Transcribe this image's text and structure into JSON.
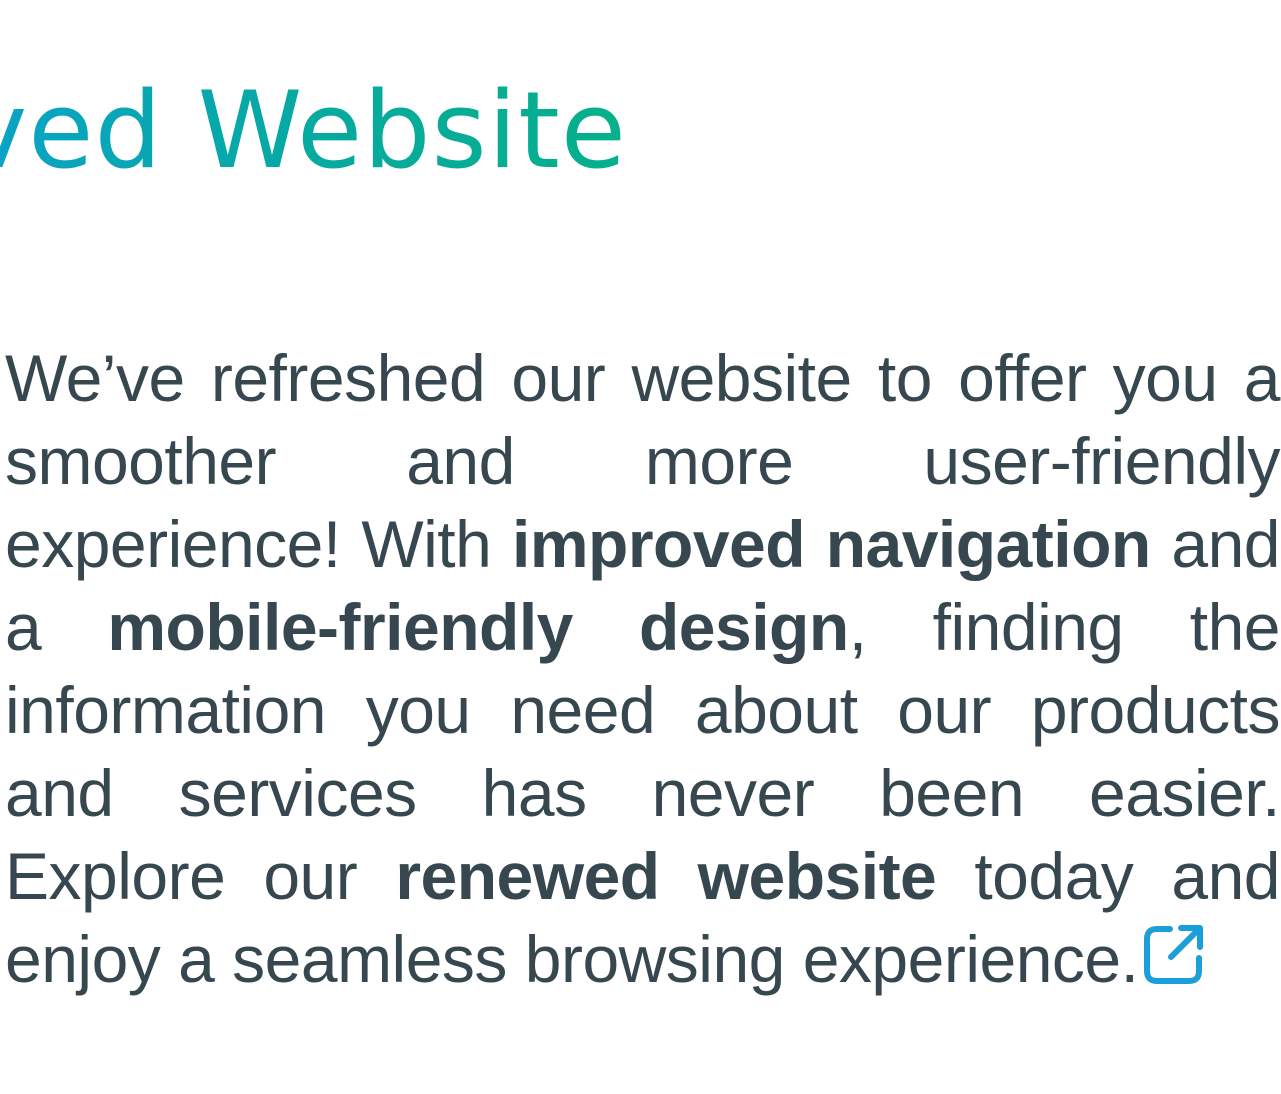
{
  "heading": {
    "title": "ved Website",
    "gradient_start": "#0aa3c8",
    "gradient_end": "#05b08a"
  },
  "content": {
    "text_color": "#37474f",
    "p1": "We’ve refreshed our website to offer you a smoother and more user-friendly experience! With ",
    "b1": "improved navigation",
    "p2": " and a ",
    "b2": "mobile-friendly design",
    "p3": ", finding the information you need about our products and services has never been easier. Explore our ",
    "b3": "renewed website",
    "p4": " today and enjoy a seamless browsing experience."
  },
  "link": {
    "icon": "external-link-icon",
    "color": "#1a9fd9"
  }
}
